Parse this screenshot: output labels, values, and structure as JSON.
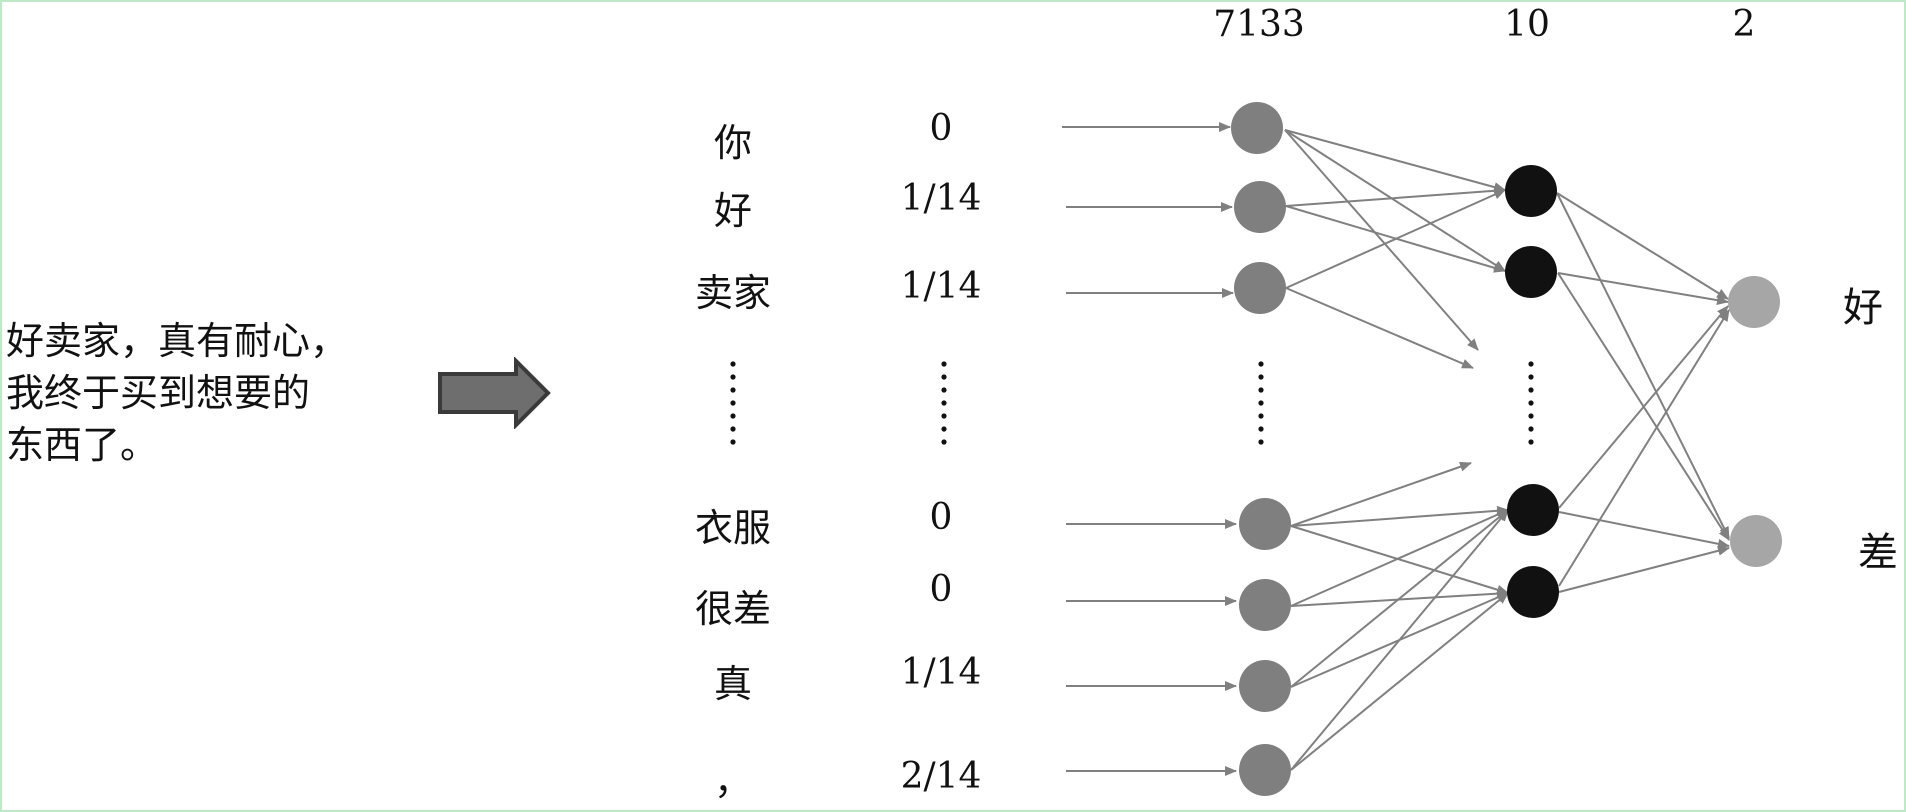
{
  "input_text": {
    "lines": [
      "好卖家，真有耐心，",
      "我终于买到想要的",
      "东西了。"
    ]
  },
  "layer_sizes": {
    "input": "7133",
    "hidden": "10",
    "output": "2"
  },
  "tokens": [
    {
      "word": "你",
      "value": "0"
    },
    {
      "word": "好",
      "value": "1/14"
    },
    {
      "word": "卖家",
      "value": "1/14"
    },
    {
      "word": "衣服",
      "value": "0"
    },
    {
      "word": "很差",
      "value": "0"
    },
    {
      "word": "真",
      "value": "1/14"
    },
    {
      "word": "，",
      "value": "2/14"
    }
  ],
  "outputs": [
    "好",
    "差"
  ],
  "colors": {
    "input_node": "#7f7f7f",
    "hidden_node": "#111111",
    "output_node": "#a6a6a6",
    "edge": "#808080",
    "arrow_fill": "#6e6e6e",
    "arrow_stroke": "#3a3a3a",
    "frame": "#bfe8c9"
  }
}
